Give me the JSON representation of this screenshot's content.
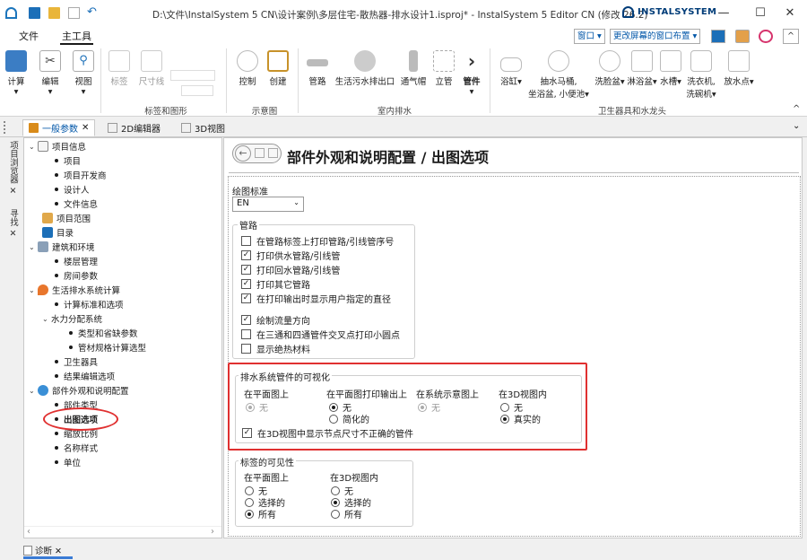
{
  "window": {
    "title": "D:\\文件\\InstalSystem 5 CN\\设计案例\\多层住宅-散热器-排水设计1.isproj* - InstalSystem 5 Editor CN (修改 26.2)",
    "brand": "INSTALSYSTEM",
    "minimize": "—",
    "maximize": "☐",
    "close": "✕"
  },
  "menu": {
    "file": "文件",
    "main_tools": "主工具",
    "window_btn": "窗口 ▾",
    "layout_btn": "更改屏幕的窗口布置 ▾",
    "collapse": "^"
  },
  "ribbon": {
    "buttons": [
      {
        "label": "计算",
        "sub": "▾"
      },
      {
        "label": "编辑",
        "sub": "▾"
      },
      {
        "label": "视图",
        "sub": "▾"
      },
      {
        "label": "标签"
      },
      {
        "label": "尺寸线"
      },
      {
        "label": "控制"
      },
      {
        "label": "创建"
      },
      {
        "label": "管路"
      },
      {
        "label": "生活污水排出口"
      },
      {
        "label": "通气帽"
      },
      {
        "label": "立管"
      },
      {
        "label": "管件",
        "sub": "▾"
      },
      {
        "label": "浴缸",
        "sub": "▾"
      },
      {
        "label": "抽水马桶,",
        "label2": "坐浴盆, 小便池▾"
      },
      {
        "label": "洗脸盆",
        "sub": "▾"
      },
      {
        "label": "淋浴盆",
        "sub": "▾"
      },
      {
        "label": "水槽",
        "sub": "▾"
      },
      {
        "label": "洗衣机,",
        "label2": "洗碗机▾"
      },
      {
        "label": "放水点",
        "sub": "▾"
      }
    ],
    "groups": [
      "标签和图形",
      "示意图",
      "室内排水",
      "卫生器具和水龙头"
    ],
    "ribbon_collapse": "^"
  },
  "tabs": {
    "general": "一般参数",
    "general_close": "✕",
    "editor2d": "2D编辑器",
    "view3d": "3D视图",
    "dropdown": "⌄"
  },
  "side": {
    "browser": "项目浏览器 ✕",
    "search": "寻找 ✕",
    "diag": "诊断 ✕"
  },
  "tree": [
    {
      "text": "项目信息",
      "type": "folder"
    },
    {
      "text": "项目",
      "type": "bullet"
    },
    {
      "text": "项目开发商",
      "type": "bullet"
    },
    {
      "text": "设计人",
      "type": "bullet"
    },
    {
      "text": "文件信息",
      "type": "bullet"
    },
    {
      "text": "项目范围",
      "type": "leaf"
    },
    {
      "text": "目录",
      "type": "leaf"
    },
    {
      "text": "建筑和环境",
      "type": "folder"
    },
    {
      "text": "楼层管理",
      "type": "bullet"
    },
    {
      "text": "房间参数",
      "type": "bullet"
    },
    {
      "text": "生活排水系统计算",
      "type": "folder"
    },
    {
      "text": "计算标准和选项",
      "type": "bullet"
    },
    {
      "text": "水力分配系统",
      "type": "subfolder"
    },
    {
      "text": "类型和省缺参数",
      "type": "bullet2"
    },
    {
      "text": "管材规格计算选型",
      "type": "bullet2"
    },
    {
      "text": "卫生器具",
      "type": "bullet"
    },
    {
      "text": "结果编辑选项",
      "type": "bullet"
    },
    {
      "text": "部件外观和说明配置",
      "type": "folder"
    },
    {
      "text": "部件类型",
      "type": "bullet"
    },
    {
      "text": "出图选项",
      "type": "bullet-bold"
    },
    {
      "text": "缩放比例",
      "type": "bullet"
    },
    {
      "text": "名称样式",
      "type": "bullet"
    },
    {
      "text": "单位",
      "type": "bullet"
    }
  ],
  "page": {
    "title": "部件外观和说明配置 / 出图选项",
    "drawing_standard_label": "绘图标准",
    "drawing_standard_value": "EN"
  },
  "pipes": {
    "title": "管路",
    "items": [
      {
        "label": "在管路标签上打印管路/引线管序号",
        "checked": false
      },
      {
        "label": "打印供水管路/引线管",
        "checked": true
      },
      {
        "label": "打印回水管路/引线管",
        "checked": true
      },
      {
        "label": "打印其它管路",
        "checked": true
      },
      {
        "label": "在打印输出时显示用户指定的直径",
        "checked": true
      },
      {
        "label": "绘制流量方向",
        "checked": true
      },
      {
        "label": "在三通和四通管件交叉点打印小圆点",
        "checked": false
      },
      {
        "label": "显示绝热材料",
        "checked": false
      }
    ]
  },
  "drain_vis": {
    "title": "排水系统管件的可视化",
    "col1": {
      "title": "在平面图上",
      "opts": [
        {
          "label": "无",
          "on": true
        }
      ]
    },
    "col2": {
      "title": "在平面图打印输出上",
      "opts": [
        {
          "label": "无",
          "on": true
        },
        {
          "label": "简化的",
          "on": false
        }
      ]
    },
    "col3": {
      "title": "在系统示意图上",
      "opts": [
        {
          "label": "无",
          "on": true
        }
      ]
    },
    "col4": {
      "title": "在3D视图内",
      "opts": [
        {
          "label": "无",
          "on": false
        },
        {
          "label": "真实的",
          "on": true
        }
      ]
    },
    "check_label": "在3D视图中显示节点尺寸不正确的管件"
  },
  "label_vis": {
    "title": "标签的可见性",
    "col1": {
      "title": "在平面图上",
      "opts": [
        {
          "label": "无",
          "on": false
        },
        {
          "label": "选择的",
          "on": false
        },
        {
          "label": "所有",
          "on": true
        }
      ]
    },
    "col2": {
      "title": "在3D视图内",
      "opts": [
        {
          "label": "无",
          "on": false
        },
        {
          "label": "选择的",
          "on": true
        },
        {
          "label": "所有",
          "on": false
        }
      ]
    }
  },
  "colors": {
    "accent": "#0056a8",
    "highlight": "#e03030"
  }
}
